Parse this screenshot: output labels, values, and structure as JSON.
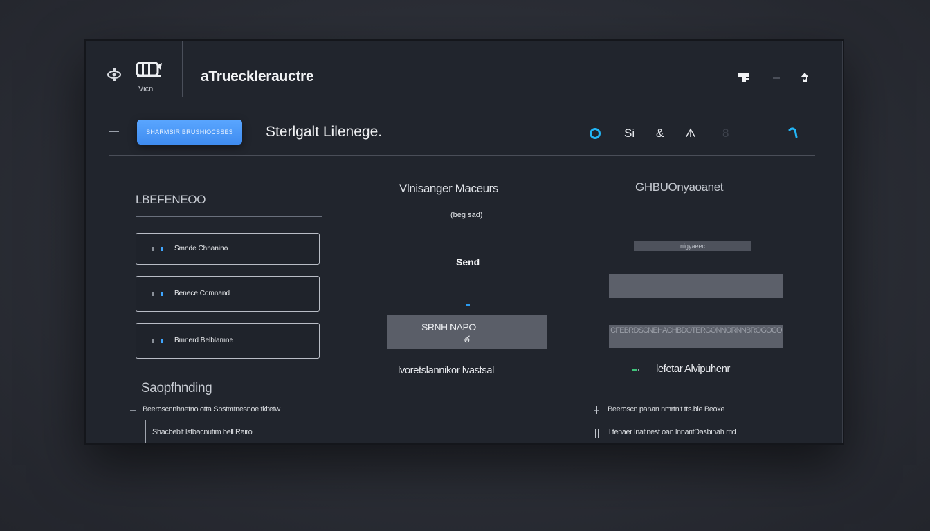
{
  "app": {
    "title": "aTruecklerauctre",
    "logo_sub": "Vicn"
  },
  "header": {
    "primary_button": "SHARMSIR BRUSHIOCSSES",
    "subtitle": "Sterlgalt Lilenege."
  },
  "toolbar_icons": {
    "s": "Si",
    "and": "&",
    "fork": "ᗑ",
    "dim": "8"
  },
  "left": {
    "heading": "LBEFENEOO",
    "items": [
      {
        "label": "Smnde Chnanino"
      },
      {
        "label": "Benece Comnand"
      },
      {
        "label": "Bmnerd Belblamne"
      }
    ]
  },
  "middle": {
    "title": "Vlnisanger Maceurs",
    "subtitle": "(beg sad)",
    "send_label": "Send",
    "card_label": "SRNH NAPO",
    "card_icon": "ఠ",
    "footer": "lvoretslannikor lvastsal"
  },
  "right": {
    "title": "GHBUOnyaoanet",
    "mini_label": "nigyaeec",
    "bar2_label": "CFEBRDSCNEHACHBDOTERGONNORNNBROGOCO",
    "footer": "lefetar Alvipuhenr"
  },
  "bottom": {
    "heading": "Saopfhnding",
    "line1": "Beeroscnnhnetno otta Sbstmtnesnoe tkitetw",
    "line2": "Shacbeblt lstbacnutim bell Rairo",
    "line3": "Beeroscn panan nmrtnit tts.bie Beoxe",
    "line4": "l tenaer lnatinest oan lnnarifDasbinah rrid"
  }
}
